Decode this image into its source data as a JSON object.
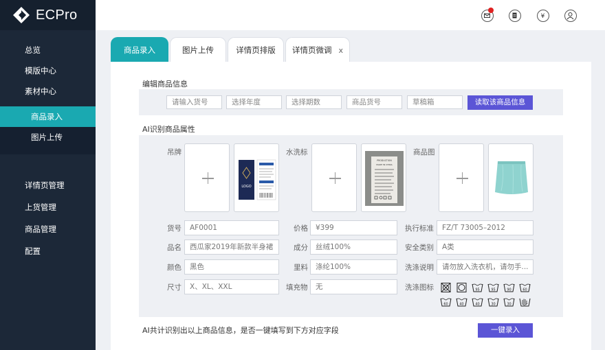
{
  "app": {
    "name": "ECPro"
  },
  "sidebar": {
    "top_items": [
      {
        "label": "总览"
      },
      {
        "label": "模版中心"
      },
      {
        "label": "素材中心"
      }
    ],
    "sub_items": [
      {
        "label": "商品录入",
        "active": true
      },
      {
        "label": "图片上传",
        "active": false
      }
    ],
    "bottom_items": [
      {
        "label": "详情页管理"
      },
      {
        "label": "上货管理"
      },
      {
        "label": "商品管理"
      },
      {
        "label": "配置"
      }
    ]
  },
  "header": {
    "icons": [
      "mail-icon",
      "document-icon",
      "yen-icon",
      "user-icon"
    ],
    "notification_color": "#e02020"
  },
  "tabs": [
    {
      "label": "商品录入",
      "active": true
    },
    {
      "label": "图片上传",
      "active": false
    },
    {
      "label": "详情页排版",
      "active": false
    },
    {
      "label": "详情页微调",
      "active": false,
      "close": "x"
    }
  ],
  "edit_section": {
    "title": "编辑商品信息",
    "inputs": [
      {
        "placeholder": "请输入货号"
      },
      {
        "placeholder": "选择年度"
      },
      {
        "placeholder": "选择期数"
      },
      {
        "placeholder": "商品货号"
      },
      {
        "placeholder": "草稿箱"
      }
    ],
    "read_button": "读取该商品信息"
  },
  "ai_section": {
    "title": "AI识别商品属性",
    "image_groups": [
      {
        "label": "吊牌",
        "thumb": "hang-tag-image"
      },
      {
        "label": "水洗标",
        "thumb": "wash-label-image"
      },
      {
        "label": "商品图",
        "thumb": "product-skirt-image"
      }
    ],
    "tag_text": {
      "logo": "LOGO"
    },
    "wash_label_text": {
      "title": "PRODUCTION",
      "made": "MADE IN CHINA"
    },
    "fields": [
      {
        "label": "货号",
        "value": "AF0001"
      },
      {
        "label": "价格",
        "value": "¥399"
      },
      {
        "label": "执行标准",
        "value": "FZ/T 73005–2012"
      },
      {
        "label": "品名",
        "value": "西瓜家2019年新款半身裙"
      },
      {
        "label": "成分",
        "value": "丝绒100%"
      },
      {
        "label": "安全类别",
        "value": "A类"
      },
      {
        "label": "颜色",
        "value": "黑色"
      },
      {
        "label": "里料",
        "value": "涤纶100%"
      },
      {
        "label": "洗涤说明",
        "value": "请勿放入洗衣机，请勿手..."
      },
      {
        "label": "尺寸",
        "value": "X、XL、XXL"
      },
      {
        "label": "填充物",
        "value": "无"
      },
      {
        "label": "洗涤图标",
        "value": ""
      }
    ],
    "care_icons_row1": [
      "no-bleach-icon",
      "tumble-dry-icon",
      "wash-95-icon",
      "wash-95-icon",
      "wash-90-icon",
      "wash-60-icon"
    ],
    "care_icons_row1_labels": [
      "",
      "",
      "95",
      "95",
      "90",
      "60"
    ],
    "care_icons_row2_labels": [
      "60",
      "40",
      "40",
      "30",
      "30",
      ""
    ],
    "care_icons_row2": [
      "wash-60-icon",
      "wash-40-icon",
      "wash-40-icon",
      "wash-30-icon",
      "wash-30-icon",
      "hand-wash-icon"
    ]
  },
  "footer": {
    "message": "AI共计识别出以上商品信息，是否一键填写到下方对应字段",
    "button": "一键录入"
  },
  "colors": {
    "accent": "#1aa9b1",
    "primary_button": "#5b55d6",
    "sidebar": "#1c2838"
  }
}
